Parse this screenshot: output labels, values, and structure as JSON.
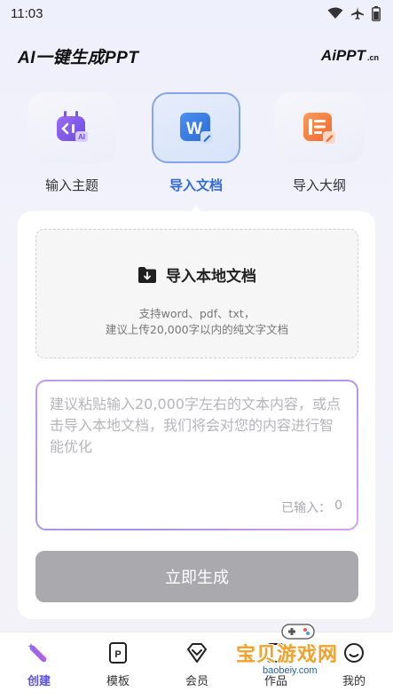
{
  "status_bar": {
    "time": "11:03"
  },
  "header": {
    "title": "AI一键生成PPT",
    "brand_main": "AiPPT",
    "brand_suffix": ".cn"
  },
  "mode_tabs": [
    {
      "label": "输入主题",
      "icon": "robot-ai-icon",
      "active": false
    },
    {
      "label": "导入文档",
      "icon": "word-document-icon",
      "active": true
    },
    {
      "label": "导入大纲",
      "icon": "outline-list-icon",
      "active": false
    }
  ],
  "upload": {
    "title": "导入本地文档",
    "hint_line1": "支持word、pdf、txt，",
    "hint_line2": "建议上传20,000字以内的纯文字文档"
  },
  "text_input": {
    "placeholder": "建议粘贴输入20,000字左右的文本内容，或点击导入本地文档，我们将会对您的内容进行智能优化",
    "count_label": "已输入：",
    "count_value": "0"
  },
  "generate_button": {
    "label": "立即生成"
  },
  "bottom_nav": [
    {
      "label": "创建",
      "icon": "magic-wand-icon",
      "active": true
    },
    {
      "label": "模板",
      "icon": "ppt-file-icon",
      "active": false
    },
    {
      "label": "会员",
      "icon": "diamond-icon",
      "active": false
    },
    {
      "label": "作品",
      "icon": "works-icon",
      "active": false
    },
    {
      "label": "我的",
      "icon": "profile-icon",
      "active": false
    }
  ],
  "watermark": {
    "text": "宝贝游戏网",
    "url": "baobeiy.com"
  },
  "colors": {
    "accent": "#2f6ad8",
    "nav_active": "#5b4de0",
    "button_disabled": "#a9a9ae"
  }
}
